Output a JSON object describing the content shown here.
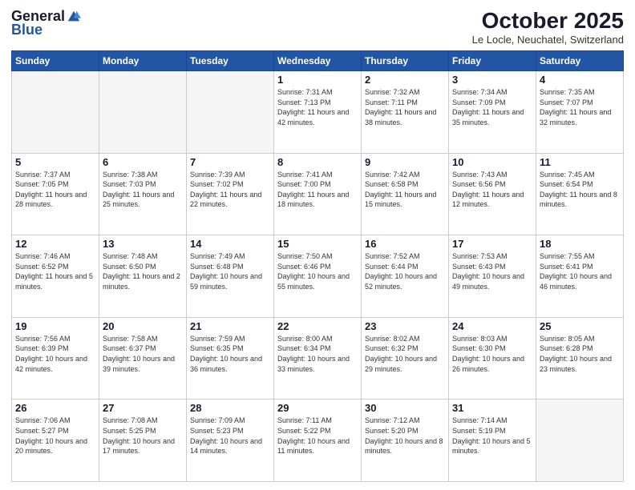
{
  "header": {
    "logo": {
      "general": "General",
      "blue": "Blue"
    },
    "title": "October 2025",
    "location": "Le Locle, Neuchatel, Switzerland"
  },
  "weekdays": [
    "Sunday",
    "Monday",
    "Tuesday",
    "Wednesday",
    "Thursday",
    "Friday",
    "Saturday"
  ],
  "weeks": [
    [
      {
        "day": "",
        "info": ""
      },
      {
        "day": "",
        "info": ""
      },
      {
        "day": "",
        "info": ""
      },
      {
        "day": "1",
        "info": "Sunrise: 7:31 AM\nSunset: 7:13 PM\nDaylight: 11 hours\nand 42 minutes."
      },
      {
        "day": "2",
        "info": "Sunrise: 7:32 AM\nSunset: 7:11 PM\nDaylight: 11 hours\nand 38 minutes."
      },
      {
        "day": "3",
        "info": "Sunrise: 7:34 AM\nSunset: 7:09 PM\nDaylight: 11 hours\nand 35 minutes."
      },
      {
        "day": "4",
        "info": "Sunrise: 7:35 AM\nSunset: 7:07 PM\nDaylight: 11 hours\nand 32 minutes."
      }
    ],
    [
      {
        "day": "5",
        "info": "Sunrise: 7:37 AM\nSunset: 7:05 PM\nDaylight: 11 hours\nand 28 minutes."
      },
      {
        "day": "6",
        "info": "Sunrise: 7:38 AM\nSunset: 7:03 PM\nDaylight: 11 hours\nand 25 minutes."
      },
      {
        "day": "7",
        "info": "Sunrise: 7:39 AM\nSunset: 7:02 PM\nDaylight: 11 hours\nand 22 minutes."
      },
      {
        "day": "8",
        "info": "Sunrise: 7:41 AM\nSunset: 7:00 PM\nDaylight: 11 hours\nand 18 minutes."
      },
      {
        "day": "9",
        "info": "Sunrise: 7:42 AM\nSunset: 6:58 PM\nDaylight: 11 hours\nand 15 minutes."
      },
      {
        "day": "10",
        "info": "Sunrise: 7:43 AM\nSunset: 6:56 PM\nDaylight: 11 hours\nand 12 minutes."
      },
      {
        "day": "11",
        "info": "Sunrise: 7:45 AM\nSunset: 6:54 PM\nDaylight: 11 hours\nand 8 minutes."
      }
    ],
    [
      {
        "day": "12",
        "info": "Sunrise: 7:46 AM\nSunset: 6:52 PM\nDaylight: 11 hours\nand 5 minutes."
      },
      {
        "day": "13",
        "info": "Sunrise: 7:48 AM\nSunset: 6:50 PM\nDaylight: 11 hours\nand 2 minutes."
      },
      {
        "day": "14",
        "info": "Sunrise: 7:49 AM\nSunset: 6:48 PM\nDaylight: 10 hours\nand 59 minutes."
      },
      {
        "day": "15",
        "info": "Sunrise: 7:50 AM\nSunset: 6:46 PM\nDaylight: 10 hours\nand 55 minutes."
      },
      {
        "day": "16",
        "info": "Sunrise: 7:52 AM\nSunset: 6:44 PM\nDaylight: 10 hours\nand 52 minutes."
      },
      {
        "day": "17",
        "info": "Sunrise: 7:53 AM\nSunset: 6:43 PM\nDaylight: 10 hours\nand 49 minutes."
      },
      {
        "day": "18",
        "info": "Sunrise: 7:55 AM\nSunset: 6:41 PM\nDaylight: 10 hours\nand 46 minutes."
      }
    ],
    [
      {
        "day": "19",
        "info": "Sunrise: 7:56 AM\nSunset: 6:39 PM\nDaylight: 10 hours\nand 42 minutes."
      },
      {
        "day": "20",
        "info": "Sunrise: 7:58 AM\nSunset: 6:37 PM\nDaylight: 10 hours\nand 39 minutes."
      },
      {
        "day": "21",
        "info": "Sunrise: 7:59 AM\nSunset: 6:35 PM\nDaylight: 10 hours\nand 36 minutes."
      },
      {
        "day": "22",
        "info": "Sunrise: 8:00 AM\nSunset: 6:34 PM\nDaylight: 10 hours\nand 33 minutes."
      },
      {
        "day": "23",
        "info": "Sunrise: 8:02 AM\nSunset: 6:32 PM\nDaylight: 10 hours\nand 29 minutes."
      },
      {
        "day": "24",
        "info": "Sunrise: 8:03 AM\nSunset: 6:30 PM\nDaylight: 10 hours\nand 26 minutes."
      },
      {
        "day": "25",
        "info": "Sunrise: 8:05 AM\nSunset: 6:28 PM\nDaylight: 10 hours\nand 23 minutes."
      }
    ],
    [
      {
        "day": "26",
        "info": "Sunrise: 7:06 AM\nSunset: 5:27 PM\nDaylight: 10 hours\nand 20 minutes."
      },
      {
        "day": "27",
        "info": "Sunrise: 7:08 AM\nSunset: 5:25 PM\nDaylight: 10 hours\nand 17 minutes."
      },
      {
        "day": "28",
        "info": "Sunrise: 7:09 AM\nSunset: 5:23 PM\nDaylight: 10 hours\nand 14 minutes."
      },
      {
        "day": "29",
        "info": "Sunrise: 7:11 AM\nSunset: 5:22 PM\nDaylight: 10 hours\nand 11 minutes."
      },
      {
        "day": "30",
        "info": "Sunrise: 7:12 AM\nSunset: 5:20 PM\nDaylight: 10 hours\nand 8 minutes."
      },
      {
        "day": "31",
        "info": "Sunrise: 7:14 AM\nSunset: 5:19 PM\nDaylight: 10 hours\nand 5 minutes."
      },
      {
        "day": "",
        "info": ""
      }
    ]
  ]
}
